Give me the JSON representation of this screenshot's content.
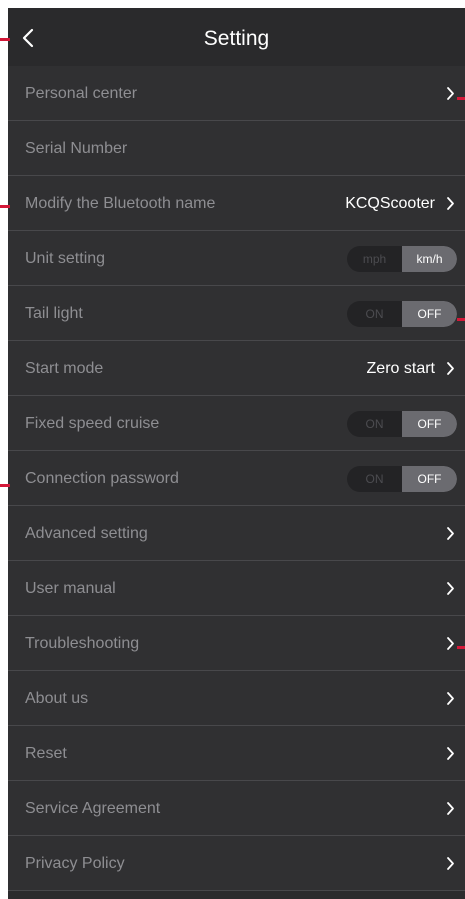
{
  "header": {
    "title": "Setting"
  },
  "rows": [
    {
      "label": "Personal center"
    },
    {
      "label": "Serial Number"
    },
    {
      "label": "Modify the Bluetooth name",
      "value": "KCQScooter"
    },
    {
      "label": "Unit setting",
      "left": "mph",
      "right": "km/h"
    },
    {
      "label": "Tail light",
      "left": "ON",
      "right": "OFF"
    },
    {
      "label": "Start mode",
      "value": "Zero start"
    },
    {
      "label": "Fixed speed cruise",
      "left": "ON",
      "right": "OFF"
    },
    {
      "label": "Connection password",
      "left": "ON",
      "right": "OFF"
    },
    {
      "label": "Advanced setting"
    },
    {
      "label": "User manual"
    },
    {
      "label": "Troubleshooting"
    },
    {
      "label": "About us"
    },
    {
      "label": "Reset"
    },
    {
      "label": "Service Agreement"
    },
    {
      "label": "Privacy Policy"
    }
  ],
  "colors": {
    "background": "#2b2b2d",
    "row_background": "#303032",
    "label": "#8e8e92",
    "toggle_active": "#6b6b70",
    "annotation_marker": "#d31838"
  },
  "icons": {
    "back": "chevron-left-icon",
    "row_arrow": "chevron-right-icon"
  }
}
